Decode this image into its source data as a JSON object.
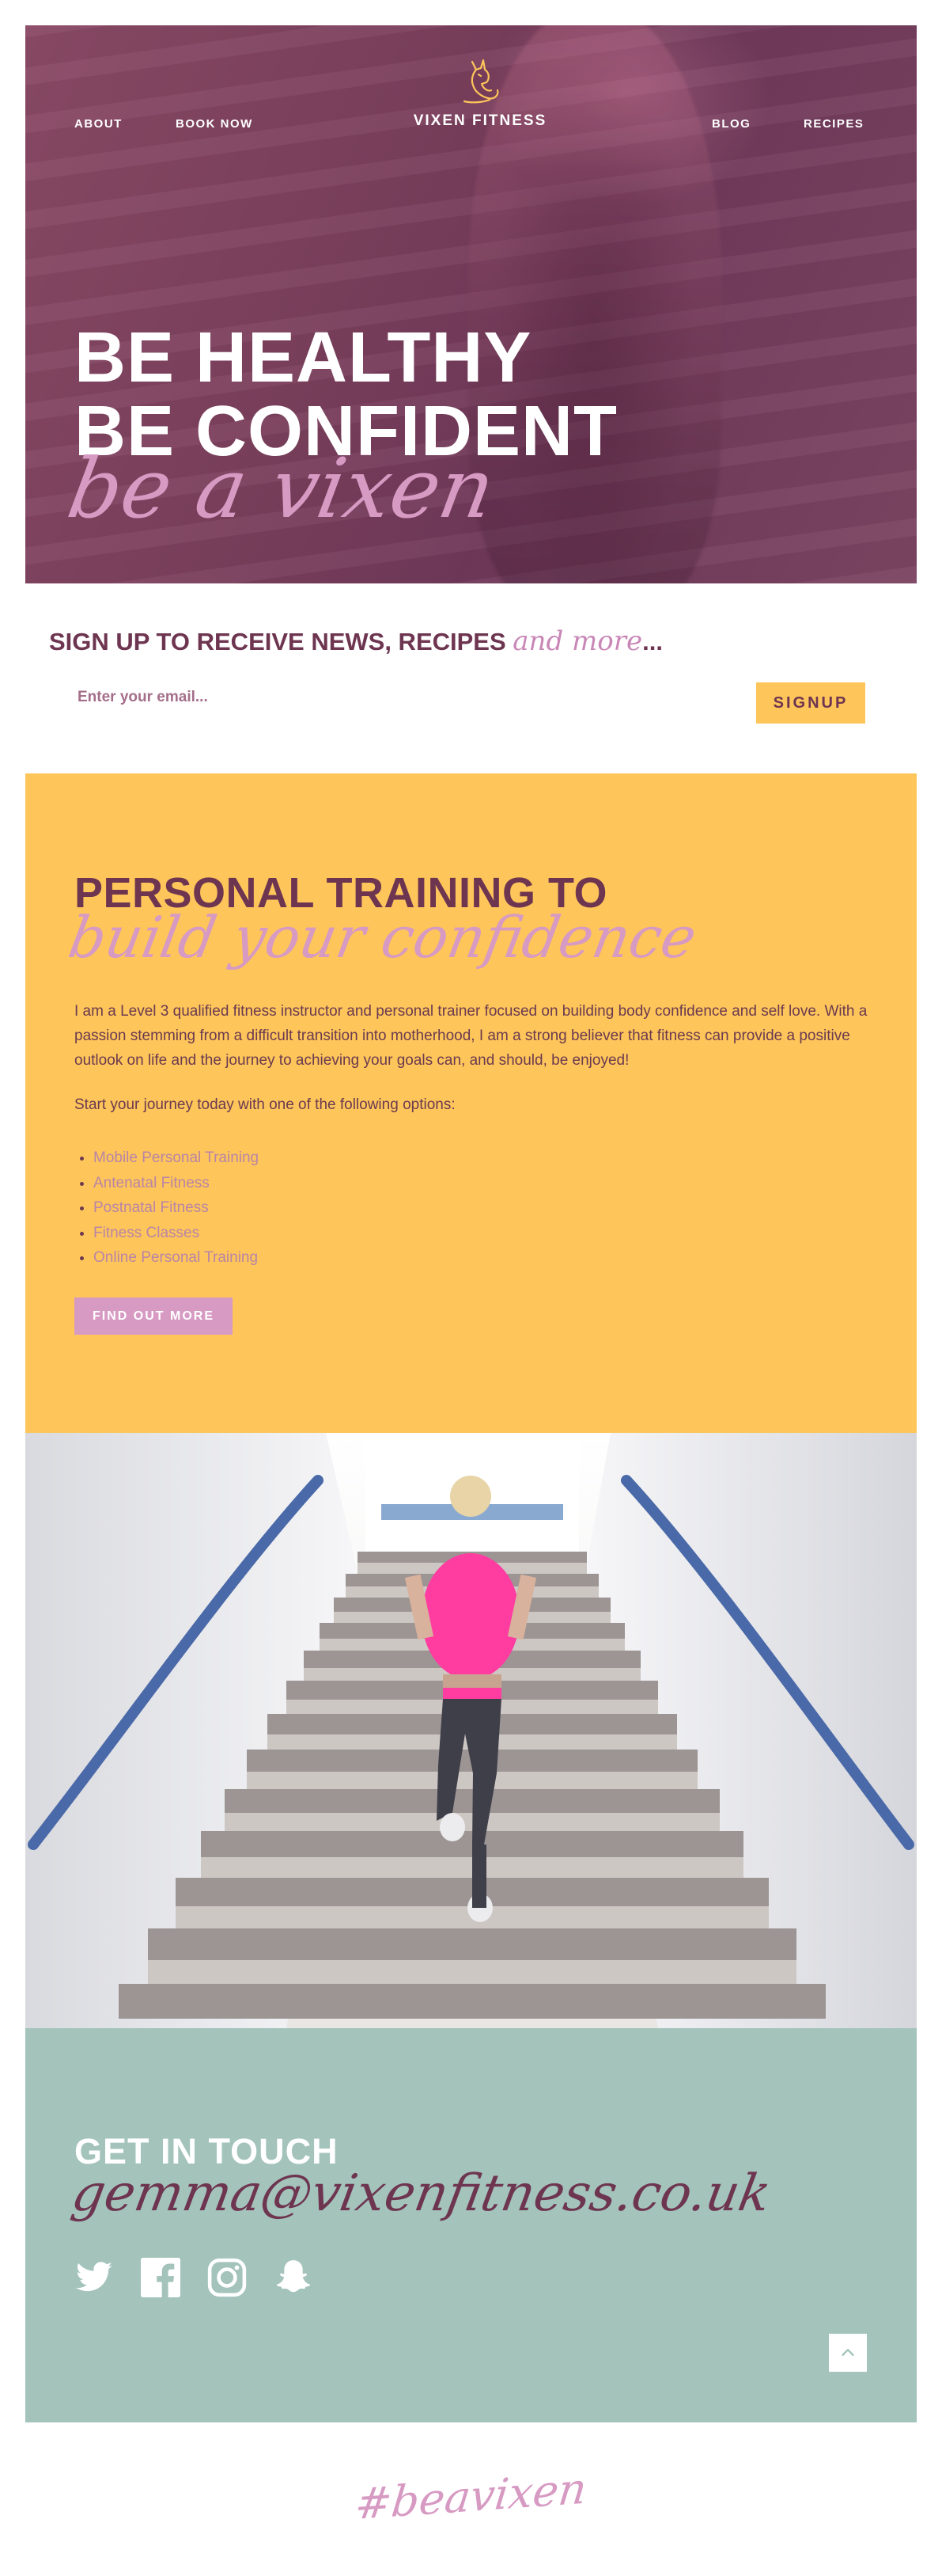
{
  "nav": {
    "about": "ABOUT",
    "book_now": "BOOK NOW",
    "blog": "BLOG",
    "recipes": "RECIPES"
  },
  "logo": {
    "text": "VIXEN FITNESS",
    "icon": "fox-icon",
    "color": "#fdc55a"
  },
  "hero": {
    "line1": "BE HEALTHY",
    "line2": "BE CONFIDENT",
    "script": "be a vixen"
  },
  "signup": {
    "heading": "SIGN UP TO RECEIVE NEWS, RECIPES",
    "heading_script": "and more",
    "heading_suffix": "...",
    "placeholder": "Enter your email...",
    "button": "SIGNUP"
  },
  "training": {
    "title": "PERSONAL TRAINING TO",
    "script": "build your confidence",
    "body": "I am a Level 3 qualified fitness instructor and personal trainer focused on building body confidence and self love. With a passion stemming from a difficult transition into motherhood, I am a strong believer that fitness can provide a positive outlook on life and the journey to achieving your goals can, and should, be enjoyed!",
    "intro": "Start your journey today with one of the following options:",
    "options": [
      "Mobile Personal Training",
      "Antenatal Fitness",
      "Postnatal Fitness",
      "Fitness Classes",
      "Online Personal Training"
    ],
    "button": "FIND OUT MORE"
  },
  "contact": {
    "title": "GET IN TOUCH",
    "email": "gemma@vixenfitness.co.uk",
    "social": [
      "twitter-icon",
      "facebook-icon",
      "instagram-icon",
      "snapchat-icon"
    ],
    "back_to_top": "chevron-up-icon"
  },
  "footer": {
    "hashtag": "#beavixen"
  },
  "colors": {
    "plum": "#6e3550",
    "pink": "#d79ac3",
    "yellow": "#fdc55a",
    "teal": "#a3c3bb"
  }
}
